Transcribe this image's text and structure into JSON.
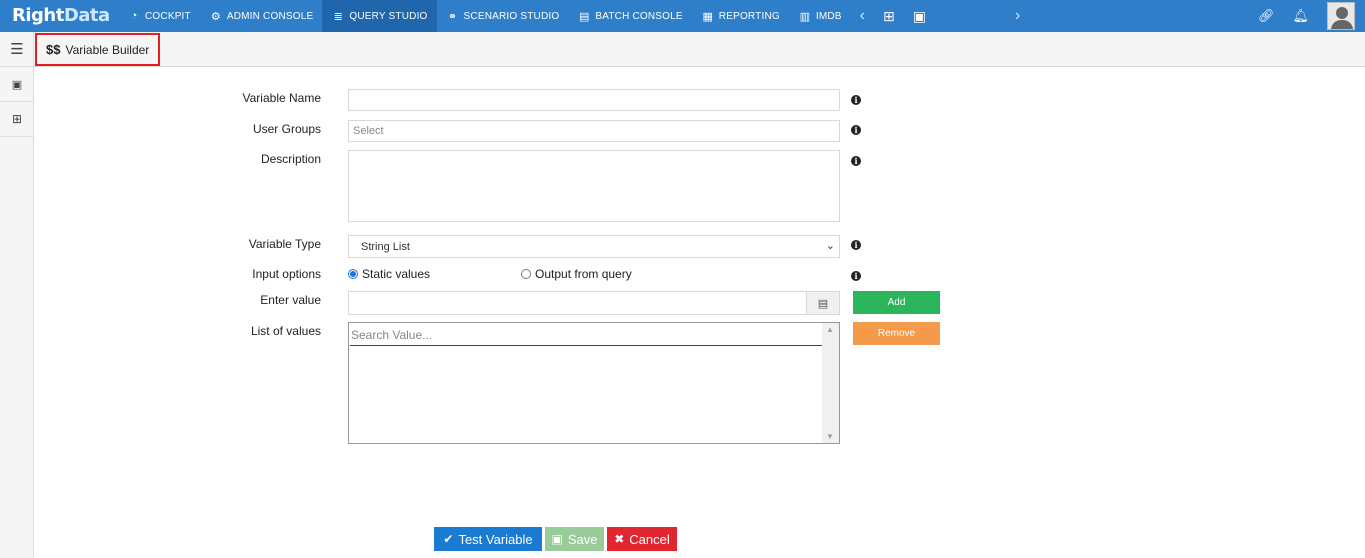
{
  "app": {
    "logo_main": "Right",
    "logo_accent": "Data"
  },
  "nav": {
    "items": [
      {
        "label": "COCKPIT",
        "icon": "gauge-icon"
      },
      {
        "label": "ADMIN CONSOLE",
        "icon": "gear-icon"
      },
      {
        "label": "QUERY STUDIO",
        "icon": "database-icon",
        "active": true
      },
      {
        "label": "SCENARIO STUDIO",
        "icon": "flow-icon"
      },
      {
        "label": "BATCH CONSOLE",
        "icon": "batch-icon"
      },
      {
        "label": "REPORTING",
        "icon": "report-icon"
      },
      {
        "label": "IMDB",
        "icon": "columns-icon"
      }
    ],
    "accent_color": "#2f7ec9",
    "active_color": "#1f66ad"
  },
  "breadcrumb": {
    "icon_text": "$$",
    "title": "Variable Builder"
  },
  "form": {
    "variable_name": {
      "label": "Variable Name",
      "value": ""
    },
    "user_groups": {
      "label": "User Groups",
      "placeholder": "Select"
    },
    "description": {
      "label": "Description",
      "value": ""
    },
    "variable_type": {
      "label": "Variable Type",
      "value": "String List"
    },
    "input_options": {
      "label": "Input options",
      "option_static": "Static values",
      "option_query": "Output from query",
      "selected": "Static values"
    },
    "enter_value": {
      "label": "Enter value",
      "value": ""
    },
    "list_of_values": {
      "label": "List of values",
      "search_placeholder": "Search Value..."
    }
  },
  "side_buttons": {
    "add": "Add",
    "remove": "Remove"
  },
  "actions": {
    "test": "Test Variable",
    "save": "Save",
    "cancel": "Cancel"
  },
  "colors": {
    "add": "#2ab55b",
    "remove": "#f5994a",
    "test": "#1a7bd0",
    "save": "#99cc99",
    "cancel": "#e0262f",
    "highlight": "#e02020"
  }
}
